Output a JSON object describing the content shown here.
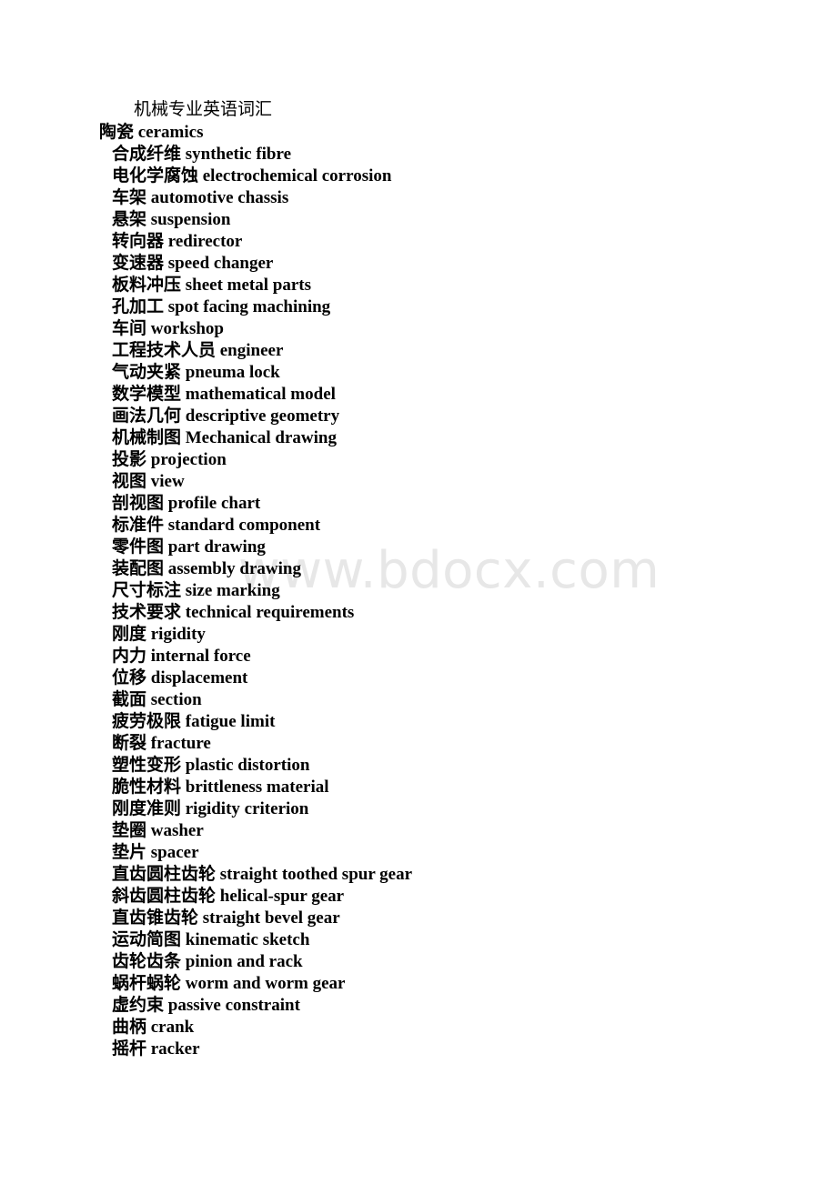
{
  "document": {
    "title": "机械专业英语词汇",
    "section_heading": "陶瓷 ceramics",
    "watermark": "www.bdocx.com",
    "entries": [
      "合成纤维 synthetic fibre",
      "电化学腐蚀 electrochemical corrosion",
      "车架 automotive chassis",
      "悬架 suspension",
      "转向器 redirector",
      "变速器 speed changer",
      "板料冲压 sheet metal parts",
      "孔加工 spot facing machining",
      "车间 workshop",
      "工程技术人员 engineer",
      "气动夹紧 pneuma lock",
      "数学模型 mathematical model",
      "画法几何 descriptive geometry",
      "机械制图 Mechanical drawing",
      "投影 projection",
      "视图 view",
      "剖视图 profile chart",
      "标准件 standard component",
      "零件图 part drawing",
      "装配图 assembly drawing",
      "尺寸标注 size marking",
      "技术要求 technical requirements",
      "刚度 rigidity",
      "内力 internal force",
      "位移 displacement",
      "截面 section",
      "疲劳极限 fatigue limit",
      "断裂 fracture",
      "塑性变形 plastic distortion",
      "脆性材料 brittleness material",
      "刚度准则 rigidity criterion",
      "垫圈 washer",
      "垫片 spacer",
      "直齿圆柱齿轮 straight toothed spur gear",
      "斜齿圆柱齿轮 helical-spur gear",
      "直齿锥齿轮 straight bevel gear",
      "运动简图 kinematic sketch",
      "齿轮齿条 pinion and rack",
      "蜗杆蜗轮 worm and worm gear",
      "虚约束 passive constraint",
      "曲柄 crank",
      "摇杆 racker"
    ]
  },
  "colors": {
    "page_background": "#ffffff",
    "text": "#000000",
    "watermark": "#e7e7e7"
  }
}
